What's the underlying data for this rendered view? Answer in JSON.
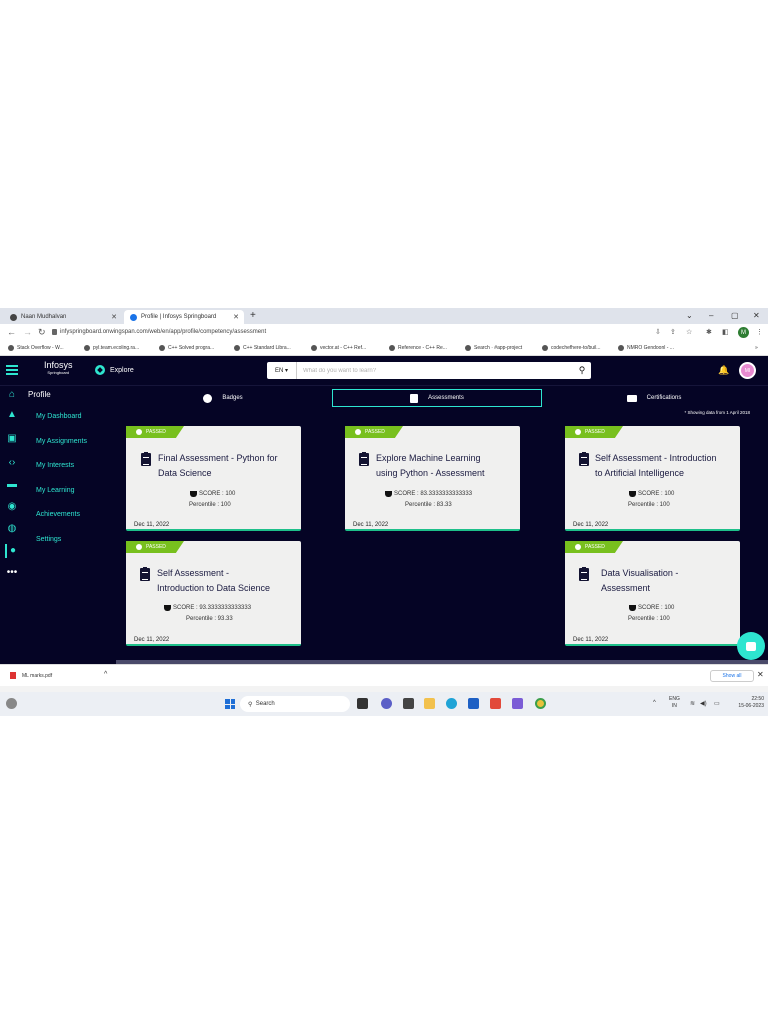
{
  "browser": {
    "tabs": [
      {
        "label": "Naan Mudhalvan",
        "active": false
      },
      {
        "label": "Profile | Infosys Springboard",
        "active": true
      }
    ],
    "url": "infyspringboard.onwingspan.com/web/en/app/profile/competency/assessment",
    "profile_initial": "M",
    "bookmarks": [
      "Stack Overflow - W...",
      "pyl.team.ecoling.ra...",
      "C++ Solved progra...",
      "C++ Standard Libra...",
      "vector.at - C++ Ref...",
      "Reference - C++ Re...",
      "Search · #app-project",
      "codechefhere-to/buil...",
      "NMRO Gendoonl - ..."
    ]
  },
  "app": {
    "logo": {
      "line1": "Infosys",
      "line2": "Springboard"
    },
    "explore_label": "Explore",
    "language": "EN",
    "search_placeholder": "What do you want to learn?",
    "avatar_initials": "MI",
    "sidebar": {
      "title": "Profile",
      "items": [
        {
          "label": "My Dashboard"
        },
        {
          "label": "My Assignments"
        },
        {
          "label": "My Interests"
        },
        {
          "label": "My Learning"
        },
        {
          "label": "Achievements"
        },
        {
          "label": "Settings"
        }
      ]
    },
    "tabs": [
      {
        "label": "Badges",
        "active": false
      },
      {
        "label": "Assessments",
        "active": true
      },
      {
        "label": "Certifications",
        "active": false
      }
    ],
    "note": "* Showing data from 1 April 2018",
    "cards": [
      {
        "status": "PASSED",
        "title_line1": "Final Assessment - Python for",
        "title_line2": "Data Science",
        "score": "SCORE : 100",
        "percentile": "Percentile : 100",
        "date": "Dec 11, 2022"
      },
      {
        "status": "PASSED",
        "title_line1": "Explore Machine Learning",
        "title_line2": "using Python - Assessment",
        "score": "SCORE : 83.3333333333333",
        "percentile": "Percentile : 83.33",
        "date": "Dec 11, 2022"
      },
      {
        "status": "PASSED",
        "title_line1": "Self Assessment - Introduction",
        "title_line2": "to Artificial Intelligence",
        "score": "SCORE : 100",
        "percentile": "Percentile : 100",
        "date": "Dec 11, 2022"
      },
      {
        "status": "PASSED",
        "title_line1": "Self Assessment -",
        "title_line2": "Introduction to Data Science",
        "score": "SCORE : 93.3333333333333",
        "percentile": "Percentile : 93.33",
        "date": "Dec 11, 2022"
      },
      {
        "status": "PASSED",
        "title_line1": "Data Visualisation -",
        "title_line2": "Assessment",
        "score": "SCORE : 100",
        "percentile": "Percentile : 100",
        "date": "Dec 11, 2022"
      }
    ]
  },
  "downloads": {
    "file": "ML marks.pdf",
    "show_all": "Show all"
  },
  "taskbar": {
    "search_label": "Search",
    "lang_line1": "ENG",
    "lang_line2": "IN",
    "time": "22:50",
    "date": "15-06-2023"
  },
  "colors": {
    "accent": "#2ee5d0",
    "app_bg": "#050425",
    "passed": "#78c01e",
    "card_bg": "#f0f0ef"
  }
}
